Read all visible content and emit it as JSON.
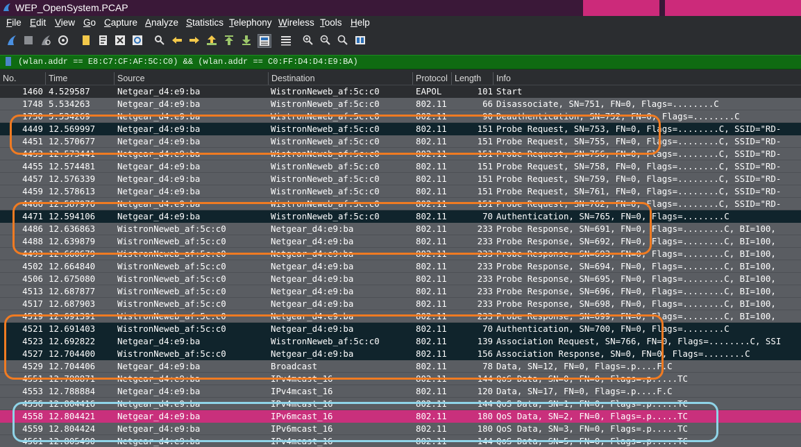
{
  "window": {
    "title": "WEP_OpenSystem.PCAP",
    "icon": "wireshark-fin-icon",
    "title_color": "#3a1838",
    "accent_color": "#cc2a7a"
  },
  "menu": {
    "items": [
      "File",
      "Edit",
      "View",
      "Go",
      "Capture",
      "Analyze",
      "Statistics",
      "Telephony",
      "Wireless",
      "Tools",
      "Help"
    ]
  },
  "toolbar": {
    "icons": [
      "start-capture-icon",
      "stop-capture-icon",
      "restart-capture-icon",
      "capture-options-icon",
      "open-file-icon",
      "save-file-icon",
      "close-file-icon",
      "reload-file-icon",
      "find-packet-icon",
      "go-back-icon",
      "go-forward-icon",
      "go-to-packet-icon",
      "go-first-icon",
      "go-last-icon",
      "auto-scroll-icon",
      "colorize-icon",
      "zoom-in-icon",
      "zoom-out-icon",
      "zoom-normal-icon",
      "resize-columns-icon"
    ]
  },
  "filter": {
    "text": "(wlan.addr == E8:C7:CF:AF:5C:C0) && (wlan.addr == C0:FF:D4:D4:E9:BA)",
    "background": "#0f6b12"
  },
  "columns": [
    "No.",
    "Time",
    "Source",
    "Destination",
    "Protocol",
    "Length",
    "Info"
  ],
  "row_colors": {
    "default": {
      "bg": "#5a5d62",
      "fg": "#ffffff"
    },
    "dark": {
      "bg": "#10242c",
      "fg": "#ffffff"
    },
    "selected": {
      "bg": "#c9307c",
      "fg": "#ffffff"
    },
    "eapol": {
      "bg": "#2b2d30",
      "fg": "#ffffff"
    }
  },
  "annotation_colors": {
    "orange": "#f07b22",
    "blue": "#8fd4e8"
  },
  "packets": [
    {
      "no": "1460",
      "time": "4.529587",
      "src": "Netgear_d4:e9:ba",
      "dst": "WistronNeweb_af:5c:c0",
      "proto": "EAPOL",
      "len": "101",
      "info": "Start",
      "style": "eapol"
    },
    {
      "no": "1748",
      "time": "5.534263",
      "src": "Netgear_d4:e9:ba",
      "dst": "WistronNeweb_af:5c:c0",
      "proto": "802.11",
      "len": "66",
      "info": "Disassociate, SN=751, FN=0, Flags=........C",
      "style": "default"
    },
    {
      "no": "1750",
      "time": "5.534269",
      "src": "Netgear_d4:e9:ba",
      "dst": "WistronNeweb_af:5c:c0",
      "proto": "802.11",
      "len": "90",
      "info": "Deauthentication, SN=752, FN=0, Flags=........C",
      "style": "default"
    },
    {
      "no": "4449",
      "time": "12.569997",
      "src": "Netgear_d4:e9:ba",
      "dst": "WistronNeweb_af:5c:c0",
      "proto": "802.11",
      "len": "151",
      "info": "Probe Request, SN=753, FN=0, Flags=........C, SSID=\"RD-",
      "style": "dark"
    },
    {
      "no": "4451",
      "time": "12.570677",
      "src": "Netgear_d4:e9:ba",
      "dst": "WistronNeweb_af:5c:c0",
      "proto": "802.11",
      "len": "151",
      "info": "Probe Request, SN=755, FN=0, Flags=........C, SSID=\"RD-",
      "style": "default"
    },
    {
      "no": "4453",
      "time": "12.573441",
      "src": "Netgear_d4:e9:ba",
      "dst": "WistronNeweb_af:5c:c0",
      "proto": "802.11",
      "len": "151",
      "info": "Probe Request, SN=756, FN=0, Flags=........C, SSID=\"RD-",
      "style": "default"
    },
    {
      "no": "4455",
      "time": "12.574481",
      "src": "Netgear_d4:e9:ba",
      "dst": "WistronNeweb_af:5c:c0",
      "proto": "802.11",
      "len": "151",
      "info": "Probe Request, SN=758, FN=0, Flags=........C, SSID=\"RD-",
      "style": "default"
    },
    {
      "no": "4457",
      "time": "12.576339",
      "src": "Netgear_d4:e9:ba",
      "dst": "WistronNeweb_af:5c:c0",
      "proto": "802.11",
      "len": "151",
      "info": "Probe Request, SN=759, FN=0, Flags=........C, SSID=\"RD-",
      "style": "default"
    },
    {
      "no": "4459",
      "time": "12.578613",
      "src": "Netgear_d4:e9:ba",
      "dst": "WistronNeweb_af:5c:c0",
      "proto": "802.11",
      "len": "151",
      "info": "Probe Request, SN=761, FN=0, Flags=........C, SSID=\"RD-",
      "style": "default"
    },
    {
      "no": "4466",
      "time": "12.587976",
      "src": "Netgear_d4:e9:ba",
      "dst": "WistronNeweb_af:5c:c0",
      "proto": "802.11",
      "len": "151",
      "info": "Probe Request, SN=762, FN=0, Flags=........C, SSID=\"RD-",
      "style": "default"
    },
    {
      "no": "4471",
      "time": "12.594106",
      "src": "Netgear_d4:e9:ba",
      "dst": "WistronNeweb_af:5c:c0",
      "proto": "802.11",
      "len": "70",
      "info": "Authentication, SN=765, FN=0, Flags=........C",
      "style": "dark"
    },
    {
      "no": "4486",
      "time": "12.636863",
      "src": "WistronNeweb_af:5c:c0",
      "dst": "Netgear_d4:e9:ba",
      "proto": "802.11",
      "len": "233",
      "info": "Probe Response, SN=691, FN=0, Flags=........C, BI=100,",
      "style": "default"
    },
    {
      "no": "4488",
      "time": "12.639879",
      "src": "WistronNeweb_af:5c:c0",
      "dst": "Netgear_d4:e9:ba",
      "proto": "802.11",
      "len": "233",
      "info": "Probe Response, SN=692, FN=0, Flags=........C, BI=100,",
      "style": "default"
    },
    {
      "no": "4493",
      "time": "12.660679",
      "src": "WistronNeweb_af:5c:c0",
      "dst": "Netgear_d4:e9:ba",
      "proto": "802.11",
      "len": "233",
      "info": "Probe Response, SN=693, FN=0, Flags=........C, BI=100,",
      "style": "default"
    },
    {
      "no": "4502",
      "time": "12.664840",
      "src": "WistronNeweb_af:5c:c0",
      "dst": "Netgear_d4:e9:ba",
      "proto": "802.11",
      "len": "233",
      "info": "Probe Response, SN=694, FN=0, Flags=........C, BI=100,",
      "style": "default"
    },
    {
      "no": "4506",
      "time": "12.675080",
      "src": "WistronNeweb_af:5c:c0",
      "dst": "Netgear_d4:e9:ba",
      "proto": "802.11",
      "len": "233",
      "info": "Probe Response, SN=695, FN=0, Flags=........C, BI=100,",
      "style": "default"
    },
    {
      "no": "4513",
      "time": "12.687877",
      "src": "WistronNeweb_af:5c:c0",
      "dst": "Netgear_d4:e9:ba",
      "proto": "802.11",
      "len": "233",
      "info": "Probe Response, SN=696, FN=0, Flags=........C, BI=100,",
      "style": "default"
    },
    {
      "no": "4517",
      "time": "12.687903",
      "src": "WistronNeweb_af:5c:c0",
      "dst": "Netgear_d4:e9:ba",
      "proto": "802.11",
      "len": "233",
      "info": "Probe Response, SN=698, FN=0, Flags=........C, BI=100,",
      "style": "default"
    },
    {
      "no": "4519",
      "time": "12.691391",
      "src": "WistronNeweb_af:5c:c0",
      "dst": "Netgear_d4:e9:ba",
      "proto": "802.11",
      "len": "233",
      "info": "Probe Response, SN=699, FN=0, Flags=........C, BI=100,",
      "style": "default"
    },
    {
      "no": "4521",
      "time": "12.691403",
      "src": "WistronNeweb_af:5c:c0",
      "dst": "Netgear_d4:e9:ba",
      "proto": "802.11",
      "len": "70",
      "info": "Authentication, SN=700, FN=0, Flags=........C",
      "style": "dark"
    },
    {
      "no": "4523",
      "time": "12.692822",
      "src": "Netgear_d4:e9:ba",
      "dst": "WistronNeweb_af:5c:c0",
      "proto": "802.11",
      "len": "139",
      "info": "Association Request, SN=766, FN=0, Flags=........C, SSI",
      "style": "dark"
    },
    {
      "no": "4527",
      "time": "12.704400",
      "src": "WistronNeweb_af:5c:c0",
      "dst": "Netgear_d4:e9:ba",
      "proto": "802.11",
      "len": "156",
      "info": "Association Response, SN=0, FN=0, Flags=........C",
      "style": "dark"
    },
    {
      "no": "4529",
      "time": "12.704406",
      "src": "Netgear_d4:e9:ba",
      "dst": "Broadcast",
      "proto": "802.11",
      "len": "78",
      "info": "Data, SN=12, FN=0, Flags=.p....F.C",
      "style": "default"
    },
    {
      "no": "4551",
      "time": "12.788871",
      "src": "Netgear_d4:e9:ba",
      "dst": "IPv4mcast_16",
      "proto": "802.11",
      "len": "144",
      "info": "QoS Data, SN=0, FN=0, Flags=.p.....TC",
      "style": "default"
    },
    {
      "no": "4553",
      "time": "12.788884",
      "src": "Netgear_d4:e9:ba",
      "dst": "IPv4mcast_16",
      "proto": "802.11",
      "len": "120",
      "info": "Data, SN=17, FN=0, Flags=.p....F.C",
      "style": "default"
    },
    {
      "no": "4556",
      "time": "12.804416",
      "src": "Netgear_d4:e9:ba",
      "dst": "IPv4mcast_16",
      "proto": "802.11",
      "len": "144",
      "info": "QoS Data, SN=1, FN=0, Flags=.p.....TC",
      "style": "default"
    },
    {
      "no": "4558",
      "time": "12.804421",
      "src": "Netgear_d4:e9:ba",
      "dst": "IPv6mcast_16",
      "proto": "802.11",
      "len": "180",
      "info": "QoS Data, SN=2, FN=0, Flags=.p.....TC",
      "style": "selected"
    },
    {
      "no": "4559",
      "time": "12.804424",
      "src": "Netgear_d4:e9:ba",
      "dst": "IPv6mcast_16",
      "proto": "802.11",
      "len": "180",
      "info": "QoS Data, SN=3, FN=0, Flags=.p.....TC",
      "style": "default"
    },
    {
      "no": "4561",
      "time": "12.805490",
      "src": "Netgear_d4:e9:ba",
      "dst": "IPv4mcast_16",
      "proto": "802.11",
      "len": "144",
      "info": "QoS Data, SN=5, FN=0, Flags=.p.....TC",
      "style": "default"
    }
  ],
  "annotations": [
    {
      "color": "orange",
      "first_packet": "1750",
      "last_packet": "4451"
    },
    {
      "color": "orange",
      "first_packet": "4466",
      "last_packet": "4488"
    },
    {
      "color": "orange",
      "first_packet": "4519",
      "last_packet": "4529"
    },
    {
      "color": "blue",
      "first_packet": "4556",
      "last_packet": "4559"
    }
  ]
}
